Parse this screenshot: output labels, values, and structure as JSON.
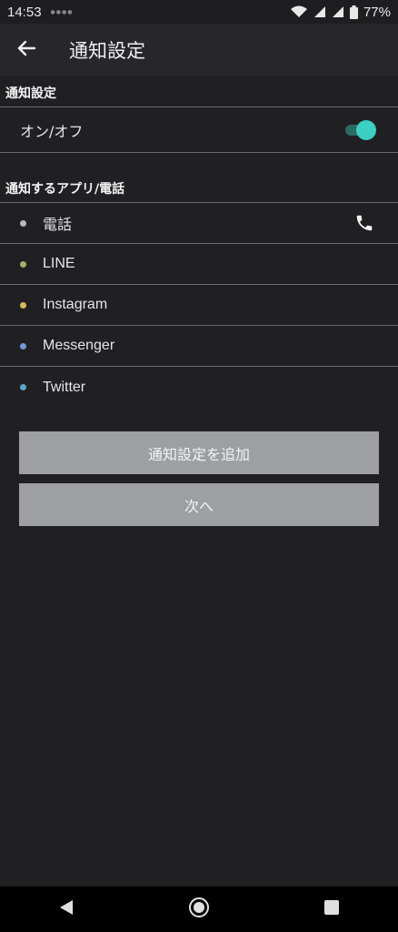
{
  "status_bar": {
    "time": "14:53",
    "battery": "77%",
    "icons": [
      "wifi-icon",
      "signal-icon",
      "signal-icon",
      "battery-icon"
    ]
  },
  "app_bar": {
    "back_icon": "arrow-left-icon",
    "title": "通知設定"
  },
  "notification_section": {
    "header": "通知設定",
    "toggle_label": "オン/オフ",
    "toggle_on": true
  },
  "apps_section": {
    "header": "通知するアプリ/電話",
    "items": [
      {
        "label": "電話",
        "dot_color": "#b9b9b9",
        "icon": "phone-icon"
      },
      {
        "label": "LINE",
        "dot_color": "#9ab56a"
      },
      {
        "label": "Instagram",
        "dot_color": "#d9b85a"
      },
      {
        "label": "Messenger",
        "dot_color": "#6e9ad6"
      },
      {
        "label": "Twitter",
        "dot_color": "#5aa7c9"
      }
    ]
  },
  "buttons": {
    "add": "通知設定を追加",
    "next": "次へ"
  },
  "nav_bar": {
    "back": "triangle-back-icon",
    "home": "circle-home-icon",
    "recents": "square-recents-icon"
  },
  "colors": {
    "background": "#202023",
    "accent": "#3ccfc3",
    "button": "#9d9fa1"
  }
}
